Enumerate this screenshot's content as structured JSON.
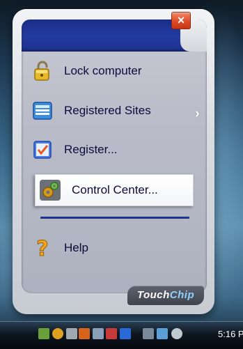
{
  "menu": {
    "close_label": "×",
    "items": [
      {
        "label": "Lock computer",
        "icon": "lock-icon"
      },
      {
        "label": "Registered Sites",
        "icon": "sites-icon",
        "submenu_arrow": "›"
      },
      {
        "label": "Register...",
        "icon": "register-icon"
      },
      {
        "label": "Control Center...",
        "icon": "control-center-icon",
        "selected": true
      },
      {
        "label": "Help",
        "icon": "help-icon"
      }
    ],
    "brand_touch": "Touch",
    "brand_chip": "Chip"
  },
  "taskbar": {
    "clock": "5:16 P",
    "tray_icons": [
      "network-icon",
      "shield-icon",
      "security-icon",
      "touchchip-icon",
      "display-icon",
      "volume-mute-icon",
      "app-icon",
      "battery-icon",
      "network-error-icon",
      "volume-icon"
    ]
  },
  "colors": {
    "title_bar": "#233aa0",
    "menu_text": "#0b0b3c",
    "close": "#de4a26",
    "divider": "#1f3390"
  }
}
